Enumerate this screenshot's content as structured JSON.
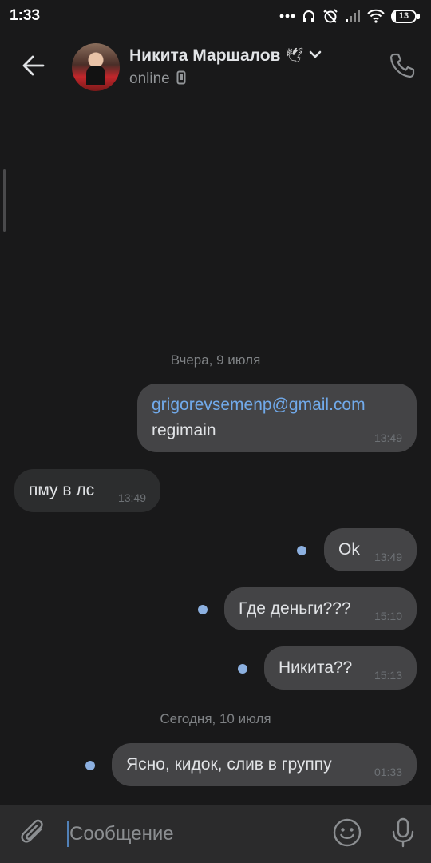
{
  "status_bar": {
    "time": "1:33",
    "battery_level": "13",
    "battery_fraction": 0.13
  },
  "header": {
    "contact_name": "Никита Маршалов",
    "badge_emoji": "🕊",
    "status": "online",
    "icons": [
      "arrow-left-icon",
      "chevron-down-icon",
      "phone-icon",
      "mobile-device-icon"
    ]
  },
  "messages": {
    "date_yesterday": "Вчера, 9 июля",
    "date_today": "Сегодня, 10 июля",
    "items": [
      {
        "direction": "out",
        "link": "grigorevsemenp@gmail.com",
        "text": "regimain",
        "time": "13:49",
        "unread": false
      },
      {
        "direction": "in",
        "text": "пму в лс",
        "time": "13:49",
        "unread": false
      },
      {
        "direction": "out",
        "text": "Ok",
        "time": "13:49",
        "unread": true
      },
      {
        "direction": "out",
        "text": "Где деньги???",
        "time": "15:10",
        "unread": true
      },
      {
        "direction": "out",
        "text": "Никита??",
        "time": "15:13",
        "unread": true
      },
      {
        "direction": "out",
        "text": "Ясно, кидок, слив в группу",
        "time": "01:33",
        "unread": true
      }
    ]
  },
  "composer": {
    "placeholder": "Сообщение",
    "icons": [
      "paperclip-icon",
      "emoji-icon",
      "microphone-icon"
    ]
  },
  "colors": {
    "background": "#19191a",
    "bubble_out": "#444446",
    "bubble_in": "#2c2d2e",
    "link": "#71aaeb",
    "unread_dot": "#8cb0e0",
    "accent": "#5181b8"
  }
}
